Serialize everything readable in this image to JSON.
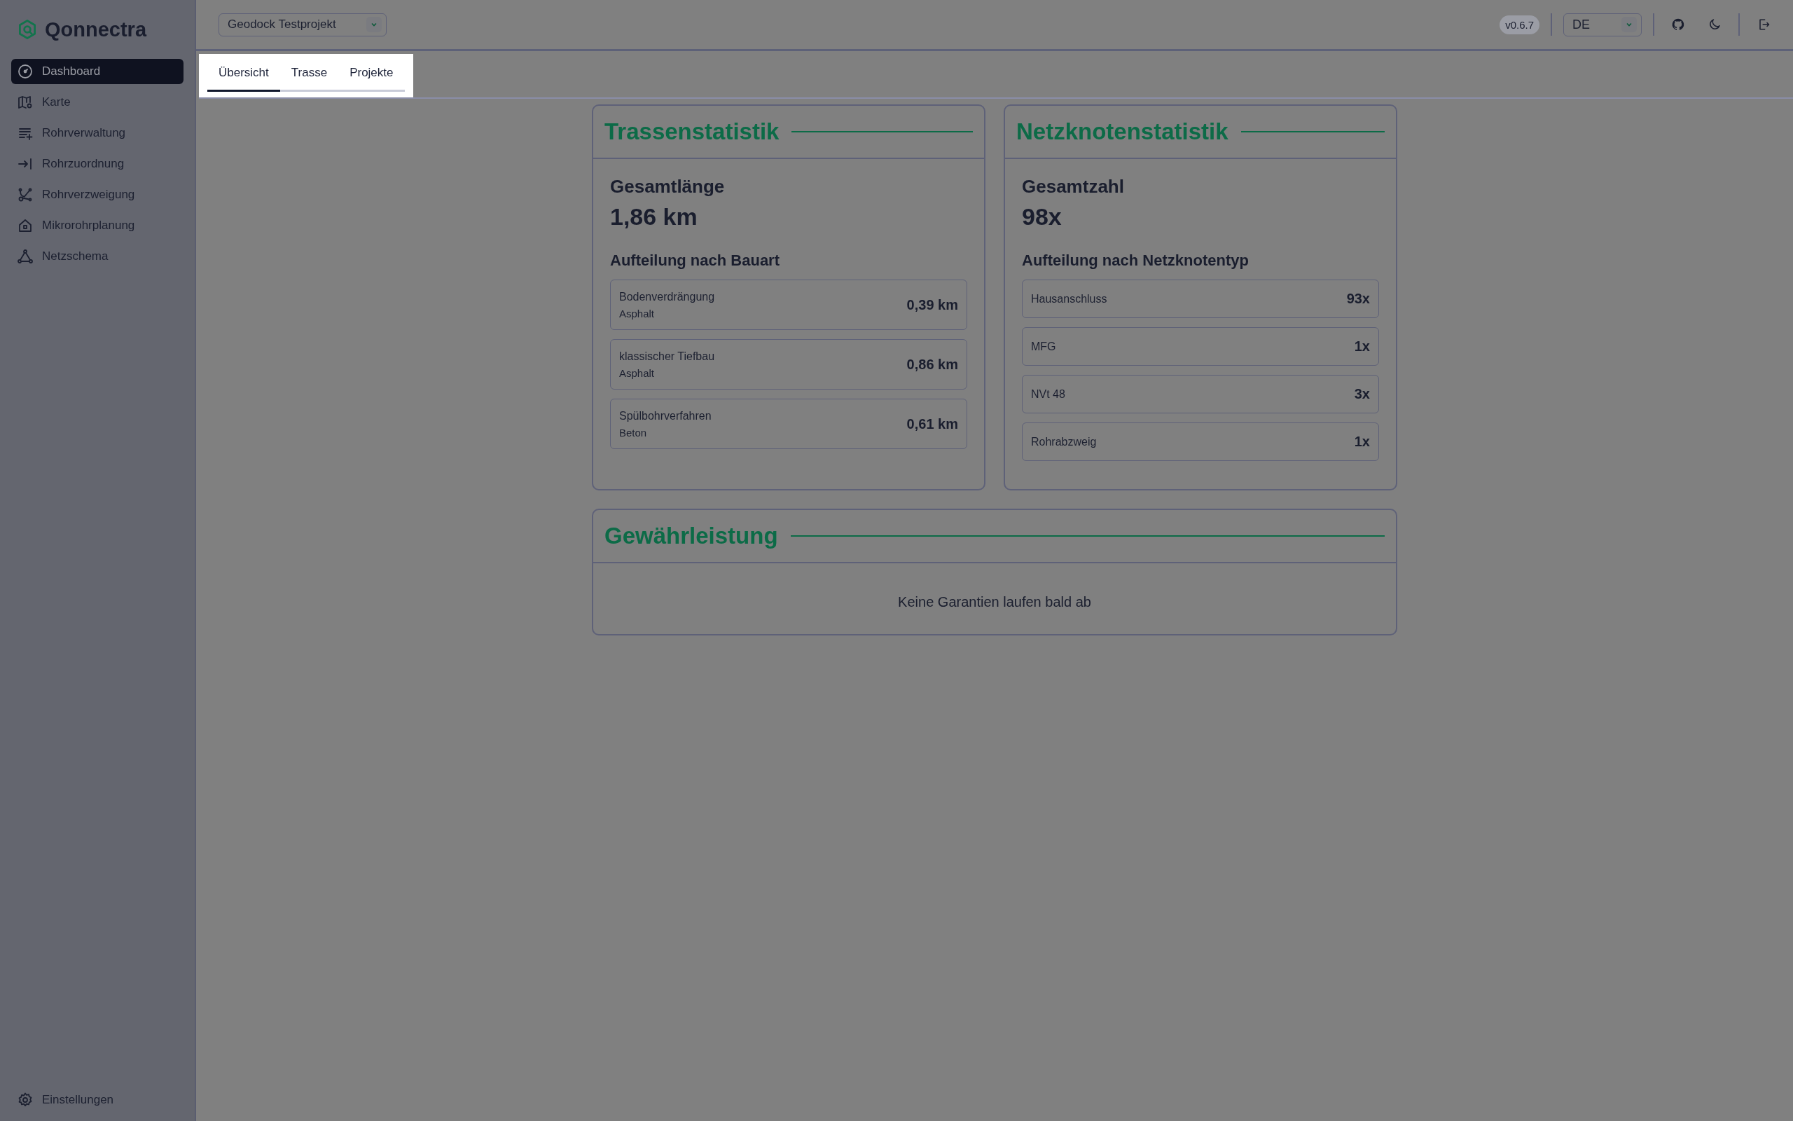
{
  "app": {
    "name": "Qonnectra"
  },
  "sidebar": {
    "items": [
      {
        "label": "Dashboard",
        "selected": true
      },
      {
        "label": "Karte",
        "selected": false
      },
      {
        "label": "Rohrverwaltung",
        "selected": false
      },
      {
        "label": "Rohrzuordnung",
        "selected": false
      },
      {
        "label": "Rohrverzweigung",
        "selected": false
      },
      {
        "label": "Mikrorohrplanung",
        "selected": false
      },
      {
        "label": "Netzschema",
        "selected": false
      }
    ],
    "footer": {
      "label": "Einstellungen"
    }
  },
  "header": {
    "project": "Geodock Testprojekt",
    "version": "v0.6.7",
    "language": "DE"
  },
  "tabs": [
    {
      "label": "Übersicht",
      "selected": true
    },
    {
      "label": "Trasse",
      "selected": false
    },
    {
      "label": "Projekte",
      "selected": false
    }
  ],
  "cards": [
    {
      "kind": "stats",
      "title": "Trassenstatistik",
      "total_label": "Gesamtlänge",
      "total": "1,86 km",
      "breakdown_title": "Aufteilung nach Bauart",
      "rows": [
        {
          "name": "Bodenverdrängung",
          "sub": "Asphalt",
          "value": "0,39 km"
        },
        {
          "name": "klassischer Tiefbau",
          "sub": "Asphalt",
          "value": "0,86 km"
        },
        {
          "name": "Spülbohrverfahren",
          "sub": "Beton",
          "value": "0,61 km"
        }
      ]
    },
    {
      "kind": "stats",
      "title": "Netzknotenstatistik",
      "total_label": "Gesamtzahl",
      "total": "98x",
      "breakdown_title": "Aufteilung nach Netzknotentyp",
      "rows": [
        {
          "name": "Hausanschluss",
          "value": "93x"
        },
        {
          "name": "MFG",
          "value": "1x"
        },
        {
          "name": "NVt 48",
          "value": "3x"
        },
        {
          "name": "Rohrabzweig",
          "value": "1x"
        }
      ]
    },
    {
      "kind": "message",
      "title": "Gewährleistung",
      "message": "Keine Garantien laufen bald ab"
    }
  ]
}
